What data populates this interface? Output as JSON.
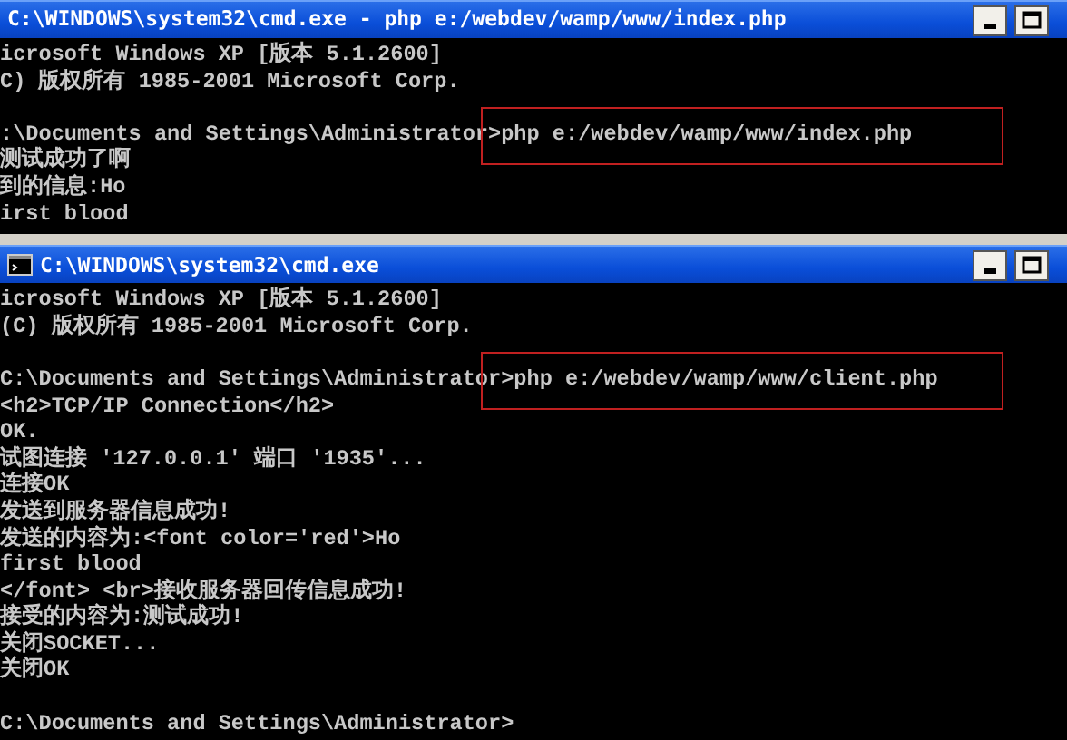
{
  "windows": [
    {
      "title": "C:\\WINDOWS\\system32\\cmd.exe - php e:/webdev/wamp/www/index.php",
      "show_icon": false,
      "lines": [
        {
          "text": "icrosoft Windows XP [版本 5.1.2600]",
          "blank_before": false,
          "highlighted": false
        },
        {
          "text": "C) 版权所有 1985-2001 Microsoft Corp.",
          "blank_before": false,
          "highlighted": false
        },
        {
          "text": ":\\Documents and Settings\\Administrator>php e:/webdev/wamp/www/index.php",
          "blank_before": true,
          "highlighted": true
        },
        {
          "text": "测试成功了啊",
          "blank_before": false,
          "highlighted": false
        },
        {
          "text": "到的信息:Ho",
          "blank_before": false,
          "highlighted": false
        },
        {
          "text": "irst blood",
          "blank_before": false,
          "highlighted": false
        }
      ]
    },
    {
      "title": "C:\\WINDOWS\\system32\\cmd.exe",
      "show_icon": true,
      "lines": [
        {
          "text": "icrosoft Windows XP [版本 5.1.2600]",
          "blank_before": false,
          "highlighted": false
        },
        {
          "text": "(C) 版权所有 1985-2001 Microsoft Corp.",
          "blank_before": false,
          "highlighted": false
        },
        {
          "text": "C:\\Documents and Settings\\Administrator>php e:/webdev/wamp/www/client.php",
          "blank_before": true,
          "highlighted": true
        },
        {
          "text": "<h2>TCP/IP Connection</h2>",
          "blank_before": false,
          "highlighted": false
        },
        {
          "text": "OK.",
          "blank_before": false,
          "highlighted": false
        },
        {
          "text": "试图连接 '127.0.0.1' 端口 '1935'...",
          "blank_before": false,
          "highlighted": false
        },
        {
          "text": "连接OK",
          "blank_before": false,
          "highlighted": false
        },
        {
          "text": "发送到服务器信息成功!",
          "blank_before": false,
          "highlighted": false
        },
        {
          "text": "发送的内容为:<font color='red'>Ho",
          "blank_before": false,
          "highlighted": false
        },
        {
          "text": "first blood",
          "blank_before": false,
          "highlighted": false
        },
        {
          "text": "</font> <br>接收服务器回传信息成功!",
          "blank_before": false,
          "highlighted": false
        },
        {
          "text": "接受的内容为:测试成功!",
          "blank_before": false,
          "highlighted": false
        },
        {
          "text": "关闭SOCKET...",
          "blank_before": false,
          "highlighted": false
        },
        {
          "text": "关闭OK",
          "blank_before": false,
          "highlighted": false
        },
        {
          "text": "C:\\Documents and Settings\\Administrator>",
          "blank_before": true,
          "highlighted": false
        }
      ]
    }
  ]
}
